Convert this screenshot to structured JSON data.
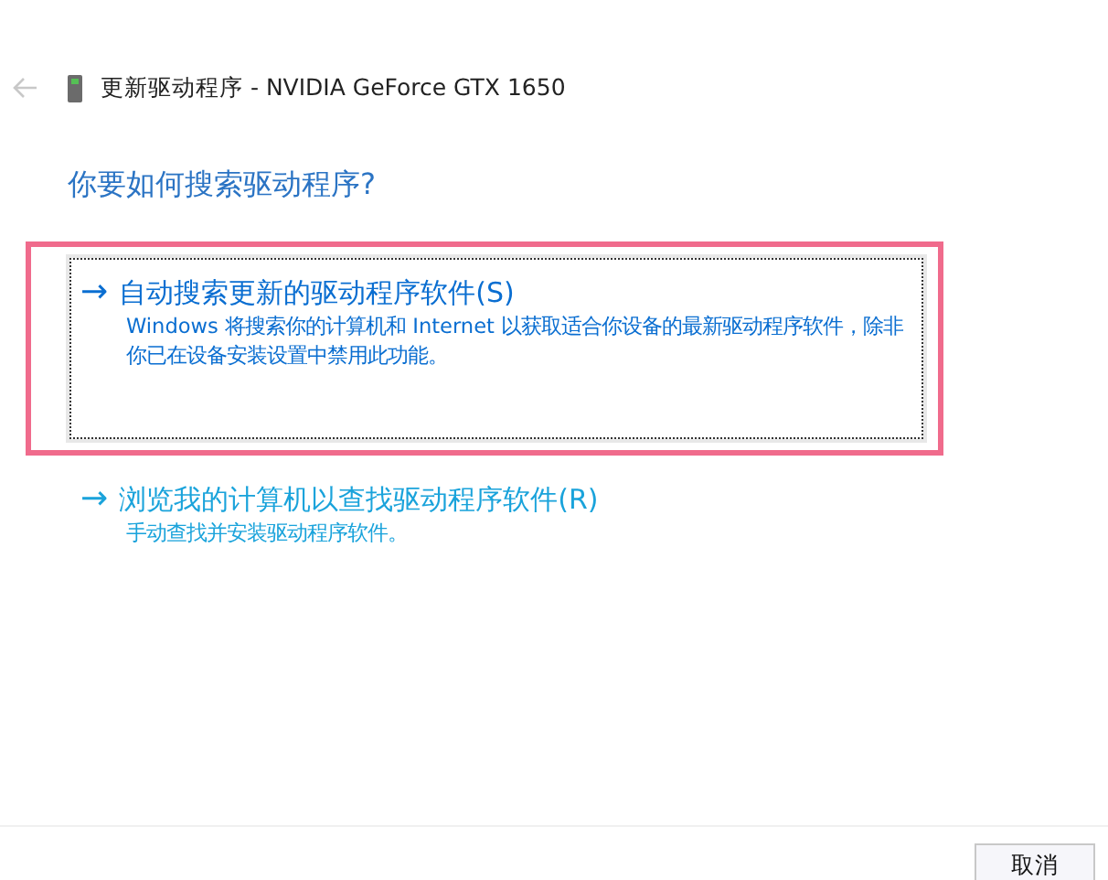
{
  "window": {
    "title": "更新驱动程序 - NVIDIA GeForce GTX 1650"
  },
  "heading": "你要如何搜索驱动程序?",
  "options": [
    {
      "arrow": "→",
      "title": "自动搜索更新的驱动程序软件(S)",
      "description": "Windows 将搜索你的计算机和 Internet 以获取适合你设备的最新驱动程序软件，除非你已在设备安装设置中禁用此功能。",
      "selected": true,
      "highlighted": true
    },
    {
      "arrow": "→",
      "title": "浏览我的计算机以查找驱动程序软件(R)",
      "description": "手动查找并安装驱动程序软件。",
      "selected": false,
      "highlighted": false
    }
  ],
  "buttons": [
    "取消"
  ]
}
